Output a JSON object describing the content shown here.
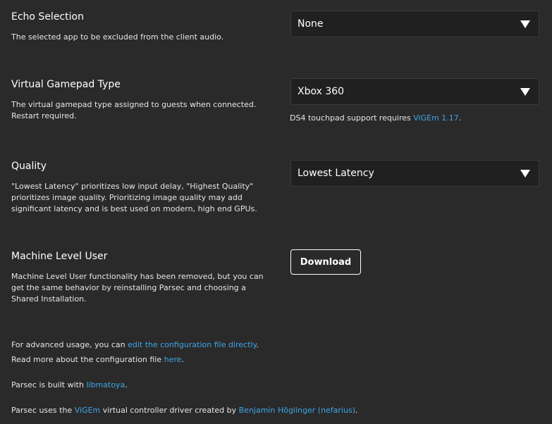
{
  "echo": {
    "label": "Echo Selection",
    "description": "The selected app to be excluded from the client audio.",
    "value": "None"
  },
  "gamepad": {
    "label": "Virtual Gamepad Type",
    "description_line1": "The virtual gamepad type assigned to guests when connected.",
    "description_line2": "Restart required.",
    "value": "Xbox 360",
    "hint_prefix": "DS4 touchpad support requires ",
    "hint_link": "ViGEm 1.17",
    "hint_suffix": "."
  },
  "quality": {
    "label": "Quality",
    "description_line1": "\"Lowest Latency\" prioritizes low input delay, \"Highest Quality\"",
    "description_line2": "prioritizes image quality. Prioritizing image quality may add",
    "description_line3": "significant latency and is best used on modern, high end GPUs.",
    "value": "Lowest Latency"
  },
  "machine_user": {
    "label": "Machine Level User",
    "description_line1": "Machine Level User functionality has been removed, but you can",
    "description_line2": "get the same behavior by reinstalling Parsec and choosing a",
    "description_line3": "Shared Installation.",
    "button_label": "Download"
  },
  "footer": {
    "advanced_prefix": "For advanced usage, you can ",
    "advanced_link": "edit the configuration file directly",
    "advanced_suffix": ".",
    "readmore_prefix": "Read more about the configuration file ",
    "readmore_link": "here",
    "readmore_suffix": ".",
    "built_prefix": "Parsec is built with ",
    "built_link": "libmatoya",
    "built_suffix": ".",
    "vigem_prefix": "Parsec uses the ",
    "vigem_link": "ViGEm",
    "vigem_middle": " virtual controller driver created by ",
    "vigem_author_link": "Benjamin Höglinger (nefarius)",
    "vigem_suffix": "."
  },
  "colors": {
    "background": "#2a2a2a",
    "link": "#3ea6e8",
    "select_background": "#202020"
  }
}
